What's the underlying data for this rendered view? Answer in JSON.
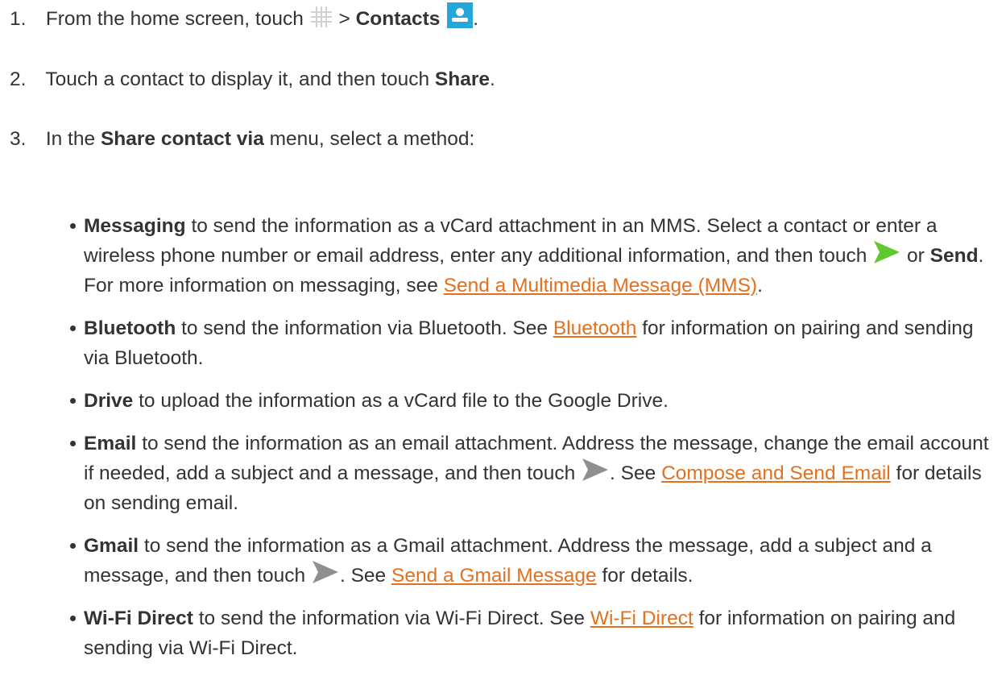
{
  "steps": [
    {
      "num": "1.",
      "pre": "From the home screen, touch",
      "sep": ">",
      "bold": "Contacts",
      "post": "."
    },
    {
      "num": "2.",
      "pre": "Touch a contact to display it, and then touch",
      "bold": "Share",
      "post": "."
    },
    {
      "num": "3.",
      "pre": "In the",
      "bold": "Share contact via",
      "post": "menu, select a method:"
    }
  ],
  "icons": {
    "apps": "apps-grid-icon",
    "contacts": "contacts-icon",
    "messaging_send": "send-arrow-icon",
    "send": "send-icon",
    "link_color": "#e3701e",
    "contacts_color": "#24a7d9",
    "messaging_send_color": "#5fc82f",
    "send_color": "#8f8f8f"
  },
  "bullets": {
    "messaging": {
      "bold": "Messaging",
      "text1": "to send the information as a vCard attachment in an MMS. Select a contact or enter a wireless phone number or email address, enter any additional information, and then touch",
      "or": "or",
      "bold2": "Send",
      "text2": ". For more information on messaging, see",
      "link": "Send a Multimedia Message (MMS)",
      "end": "."
    },
    "bluetooth": {
      "bold": "Bluetooth",
      "text1": "to send the information via Bluetooth. See",
      "link": "Bluetooth",
      "text2": "for information on pairing and sending via Bluetooth."
    },
    "drive": {
      "bold": "Drive",
      "text1": "to upload the information as a vCard file to the Google Drive."
    },
    "email": {
      "bold": "Email",
      "text1": "to send the information as an email attachment. Address the message, change the email account if needed, add a subject and a message, and then touch",
      "text2": ". See",
      "link": "Compose and Send Email",
      "text3": "for details on sending email."
    },
    "gmail": {
      "bold": "Gmail",
      "text1": "to send the information as a Gmail attachment. Address the message, add a subject and a message, and then touch",
      "text2": ". See",
      "link": "Send a Gmail Message",
      "text3": "for details."
    },
    "wifi": {
      "bold": "Wi-Fi Direct",
      "text1": "to send the information via Wi-Fi Direct. See",
      "link": "Wi-Fi Direct",
      "text2": "for information on pairing and sending via Wi-Fi Direct."
    }
  }
}
